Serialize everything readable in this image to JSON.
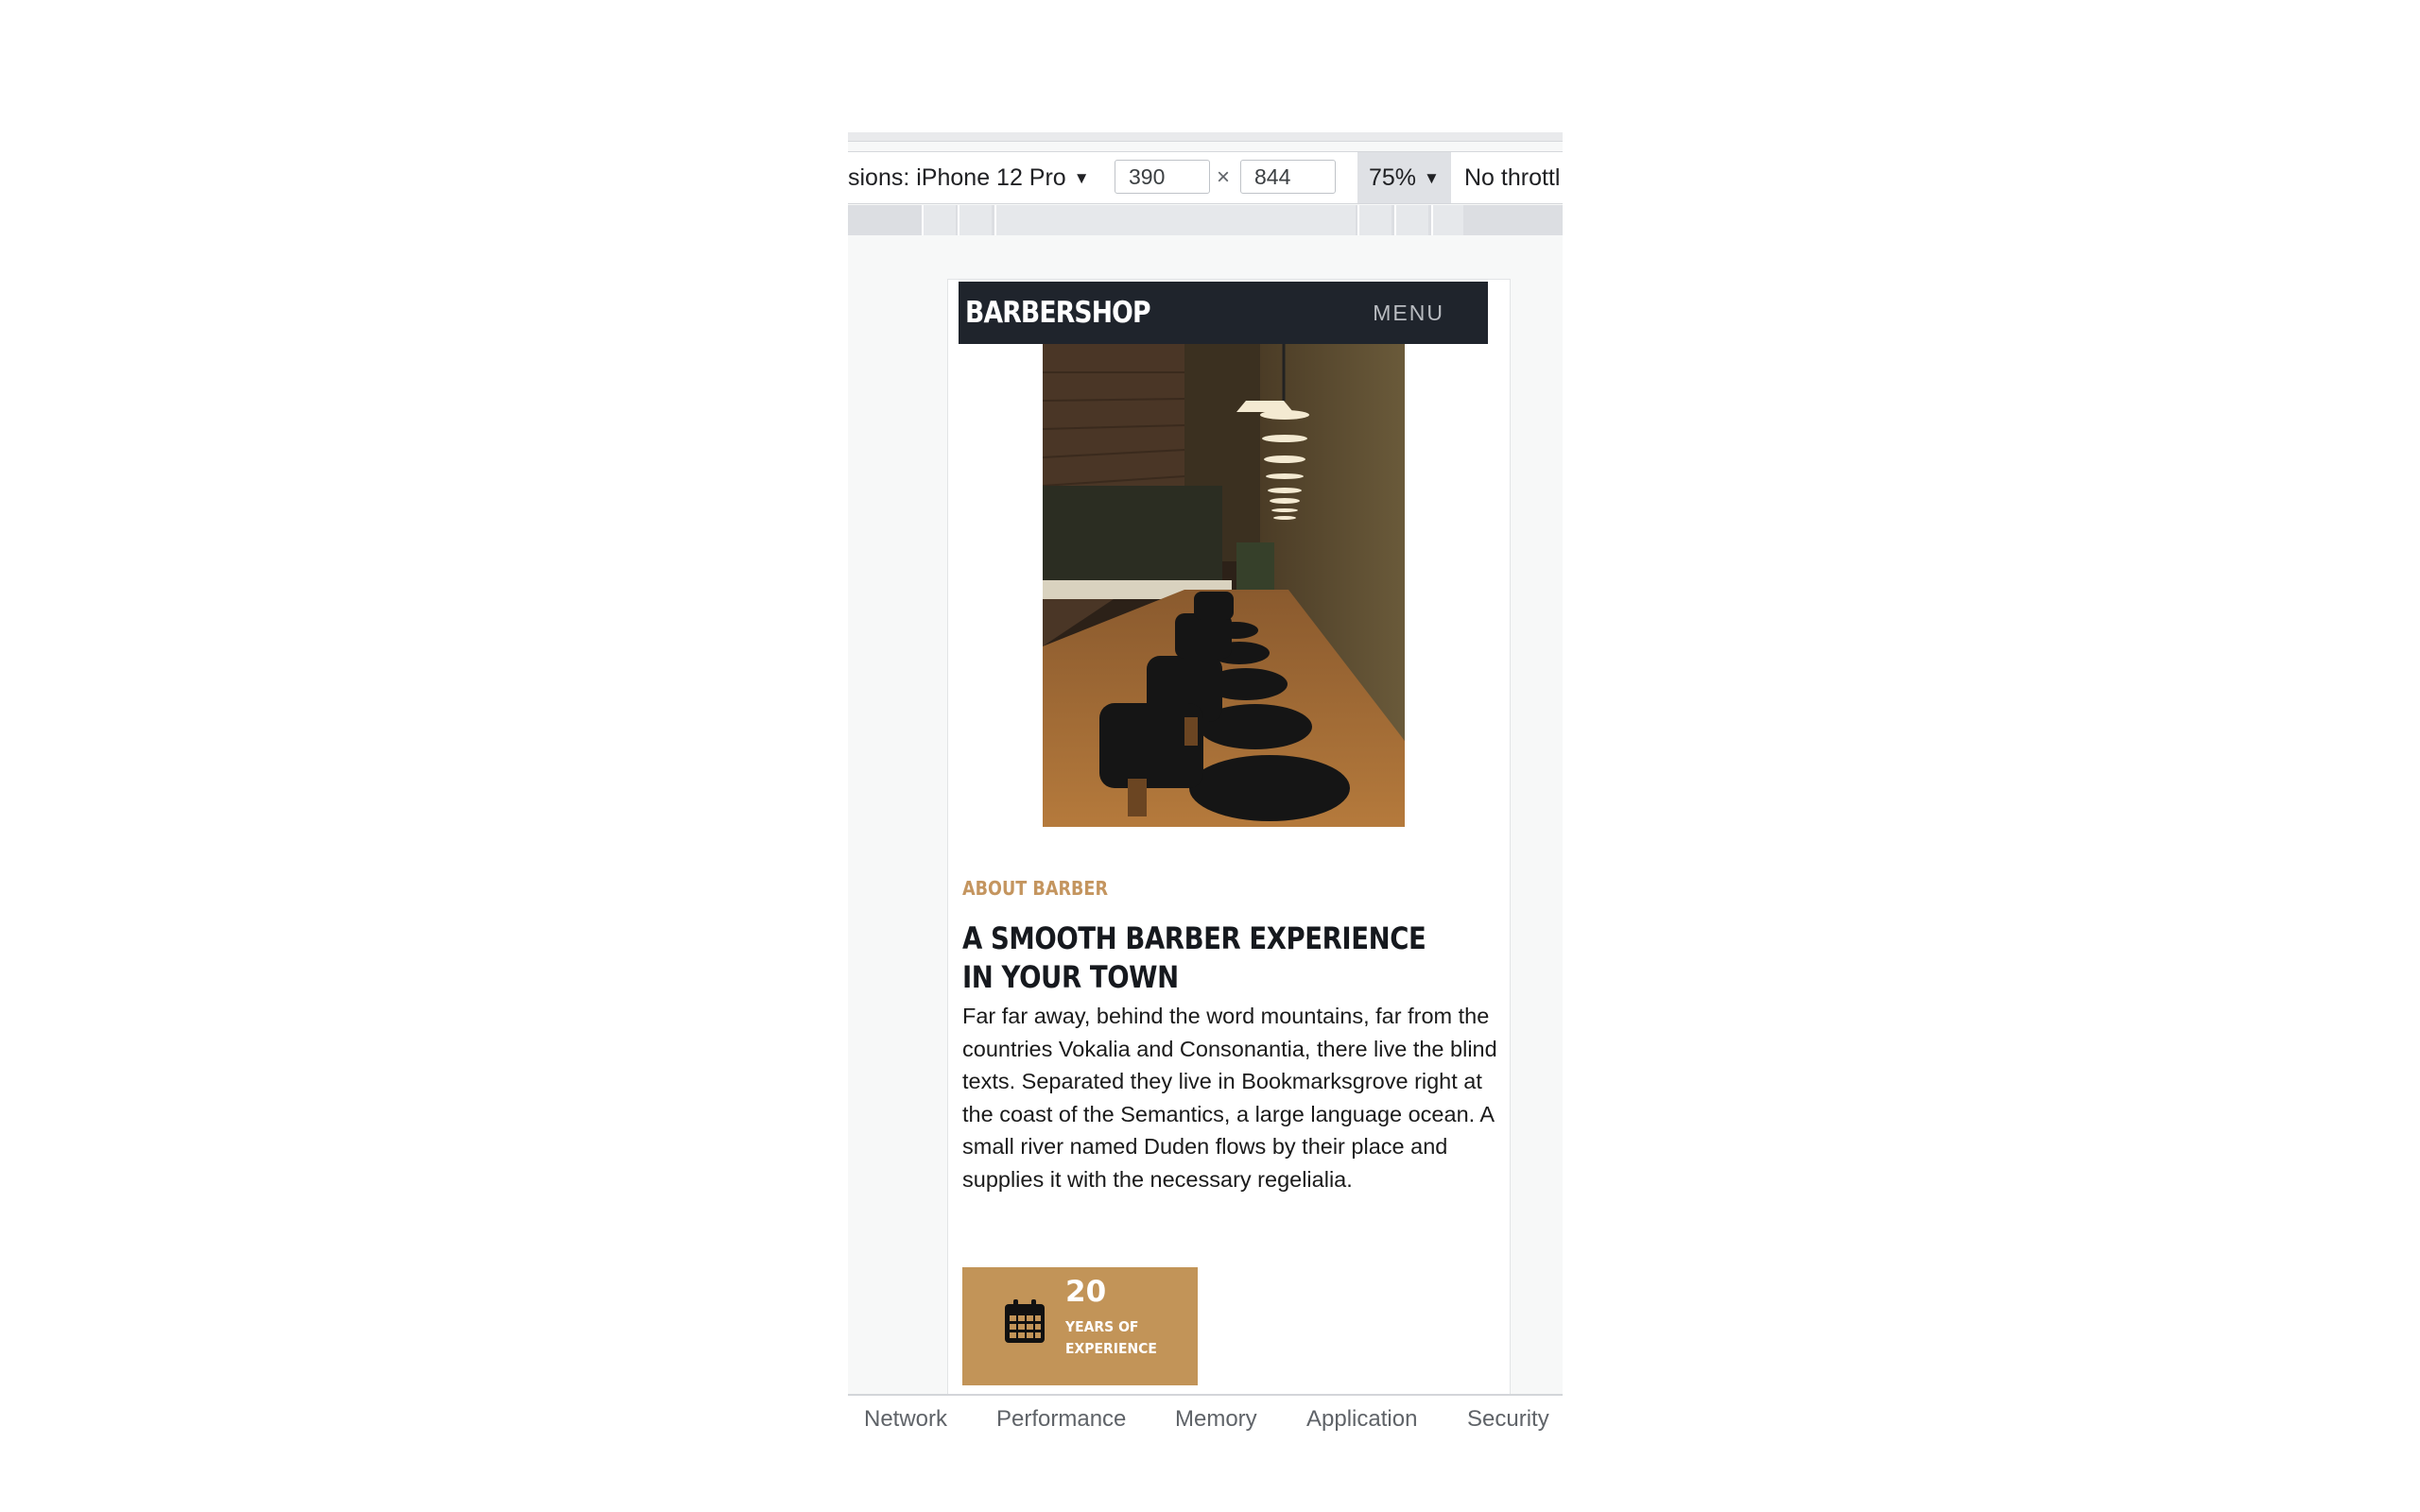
{
  "devtools": {
    "device_label": "sions: iPhone 12 Pro",
    "width_value": "390",
    "height_value": "844",
    "times_symbol": "×",
    "zoom": "75%",
    "throttle": "No throttl",
    "caret": "▼"
  },
  "site": {
    "brand": "BARBERSHOP",
    "menu": "MENU",
    "about_label": "ABOUT BARBER",
    "headline_lines": [
      "A SMOOTH BARBER EXPERIENCE",
      "IN YOUR TOWN"
    ],
    "body": "Far far away, behind the word mountains, far from the countries Vokalia and Consonantia, there live the blind texts. Separated they live in Bookmarksgrove right at the coast of the Semantics, a large language ocean. A small river named Duden flows by their place and supplies it with the necessary regelialia.",
    "experience": {
      "number": "20",
      "lines": [
        "YEARS OF",
        "EXPERIENCE"
      ],
      "icon": "calendar-icon"
    },
    "accent_color": "#c29458",
    "nav_color": "#1f242c"
  },
  "drawer_tabs": [
    "Network",
    "Performance",
    "Memory",
    "Application",
    "Security"
  ]
}
